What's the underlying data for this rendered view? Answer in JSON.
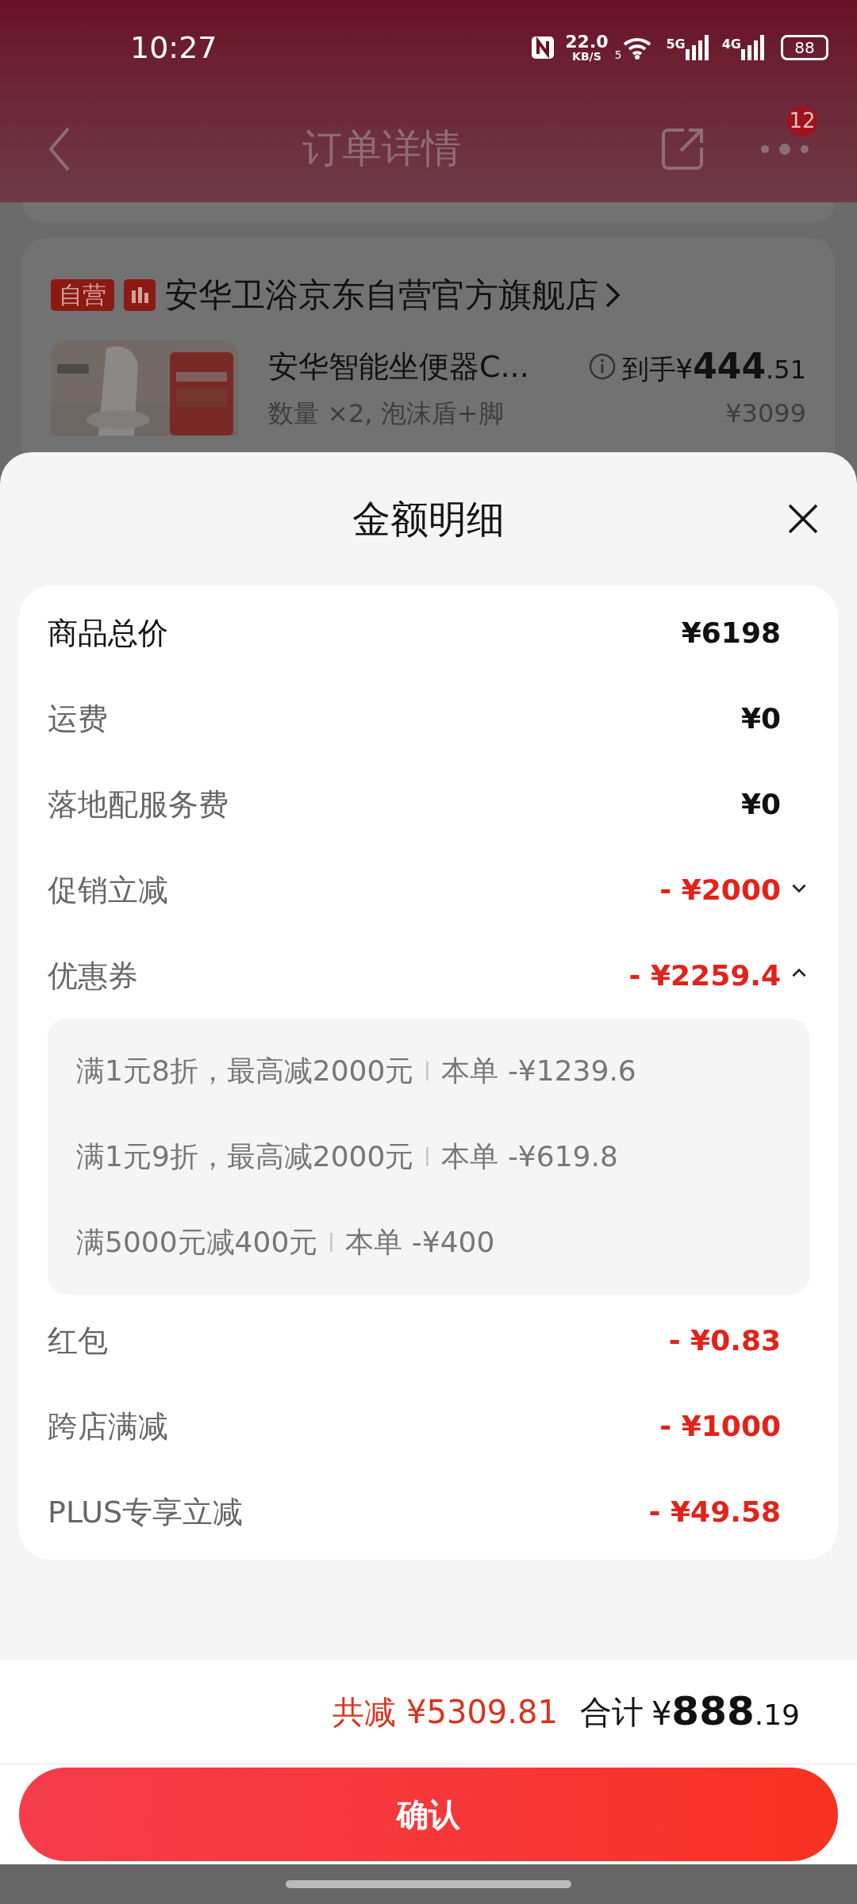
{
  "status_bar": {
    "time": "10:27",
    "speed": "22.0",
    "speed_unit": "KB/S",
    "wifi_band": "5",
    "net_1": "5G",
    "net_2": "4G",
    "battery": "88"
  },
  "header": {
    "title": "订单详情",
    "badge": "12"
  },
  "store": {
    "tag": "自营",
    "name": "安华卫浴京东自营官方旗舰店"
  },
  "product": {
    "name": "安华智能坐便器C...",
    "spec": "数量 ×2, 泡沫盾+脚",
    "price_prefix": "到手¥",
    "price_main": "444",
    "price_decimals": ".51",
    "original_price": "¥3099"
  },
  "sheet": {
    "title": "金额明细",
    "rows": [
      {
        "kind": "total",
        "label": "商品总价",
        "amount": "¥6198"
      },
      {
        "kind": "fee",
        "label": "运费",
        "amount": "¥0"
      },
      {
        "kind": "fee",
        "label": "落地配服务费",
        "amount": "¥0"
      },
      {
        "kind": "discount",
        "label": "促销立减",
        "amount": "- ¥2000",
        "expanded": false
      },
      {
        "kind": "discount",
        "label": "优惠券",
        "amount": "- ¥2259.4",
        "expanded": true,
        "details": [
          {
            "rule": "满1元8折，最高减2000元",
            "value": "本单 -¥1239.6"
          },
          {
            "rule": "满1元9折，最高减2000元",
            "value": "本单 -¥619.8"
          },
          {
            "rule": "满5000元减400元",
            "value": "本单 -¥400"
          }
        ]
      },
      {
        "kind": "discount",
        "label": "红包",
        "amount": "- ¥0.83"
      },
      {
        "kind": "discount",
        "label": "跨店满减",
        "amount": "- ¥1000"
      },
      {
        "kind": "discount",
        "label": "PLUS专享立减",
        "amount": "- ¥49.58"
      }
    ]
  },
  "footer": {
    "saved": "共减 ¥5309.81",
    "total_label": "合计",
    "total_prefix": "¥",
    "total_main": "888",
    "total_decimals": ".19",
    "confirm": "确认"
  }
}
